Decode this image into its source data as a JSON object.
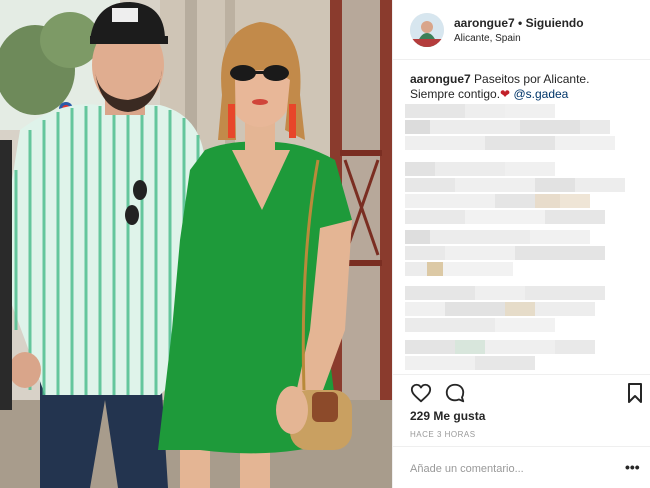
{
  "post": {
    "photo_icon": "photo-couple-icon"
  },
  "header": {
    "username": "aarongue7",
    "separator": "•",
    "follow_status": "Siguiendo",
    "location": "Alicante, Spain"
  },
  "caption": {
    "username": "aarongue7",
    "text_line1": "Paseitos por Alicante.",
    "text_line2": "Siempre contigo.",
    "mention": "@s.gadea"
  },
  "actions": {
    "like_icon": "heart-icon",
    "comment_icon": "comment-bubble-icon",
    "save_icon": "bookmark-icon",
    "likes": "229 Me gusta",
    "time": "HACE 3 HORAS"
  },
  "comment": {
    "placeholder": "Añade un comentario...",
    "more": "•••"
  },
  "colors": {
    "link": "#003569",
    "heart": "#c2212a",
    "dress_green": "#1e9a3a",
    "shirt_stripe": "#4fbf8f"
  }
}
